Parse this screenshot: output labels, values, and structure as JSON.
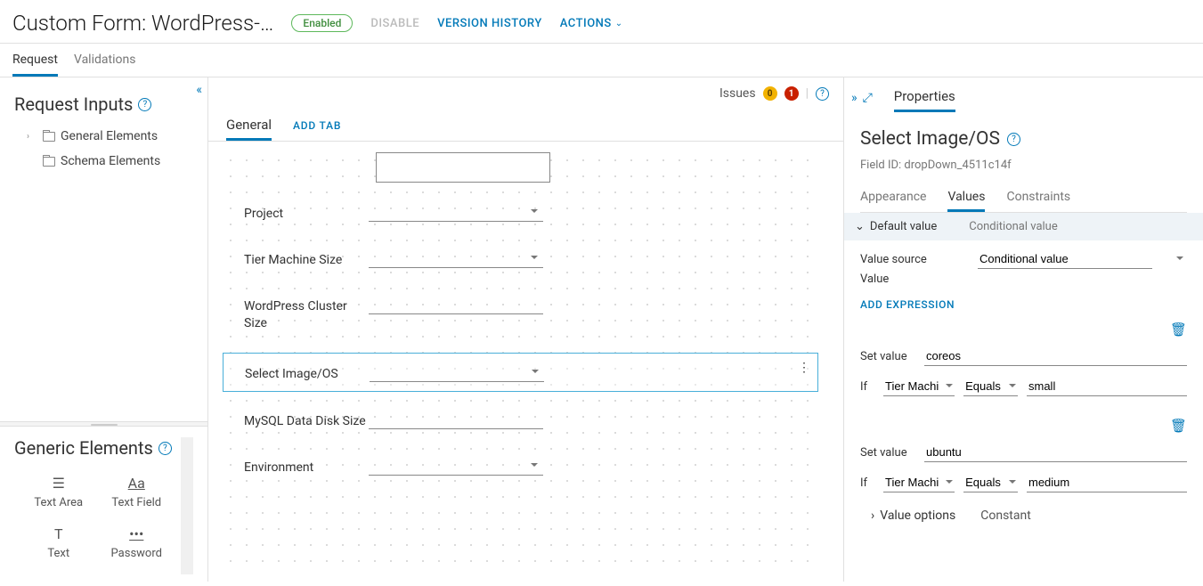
{
  "header": {
    "title": "Custom Form: WordPress-…",
    "status_badge": "Enabled",
    "disable": "DISABLE",
    "version_history": "VERSION HISTORY",
    "actions": "ACTIONS"
  },
  "main_tabs": {
    "request": "Request",
    "validations": "Validations"
  },
  "left": {
    "request_inputs_title": "Request Inputs",
    "tree": {
      "general": "General Elements",
      "schema": "Schema Elements"
    },
    "generic_title": "Generic Elements",
    "items": {
      "text_area": "Text Area",
      "text_field": "Text Field",
      "text": "Text",
      "password": "Password"
    }
  },
  "canvas": {
    "issues_label": "Issues",
    "warn_count": "0",
    "err_count": "1",
    "tabs": {
      "general": "General",
      "add": "ADD TAB"
    },
    "fields": {
      "project": "Project",
      "tier": "Tier Machine Size",
      "cluster": "WordPress Cluster Size",
      "image": "Select Image/OS",
      "disk": "MySQL Data Disk Size",
      "env": "Environment"
    }
  },
  "right": {
    "panel_tab": "Properties",
    "title": "Select Image/OS",
    "field_id": "Field ID: dropDown_4511c14f",
    "tabs": {
      "appearance": "Appearance",
      "values": "Values",
      "constraints": "Constraints"
    },
    "acc": {
      "default": "Default value",
      "conditional": "Conditional value"
    },
    "value_source_label": "Value source",
    "value_source_value": "Conditional value",
    "value_label": "Value",
    "add_expression": "ADD EXPRESSION",
    "expr": [
      {
        "set_val_label": "Set value",
        "set_val": "coreos",
        "if_label": "If",
        "field": "Tier Machi…",
        "op": "Equals",
        "val": "small"
      },
      {
        "set_val_label": "Set value",
        "set_val": "ubuntu",
        "if_label": "If",
        "field": "Tier Machi…",
        "op": "Equals",
        "val": "medium"
      }
    ],
    "value_options": "Value options",
    "constant": "Constant"
  }
}
